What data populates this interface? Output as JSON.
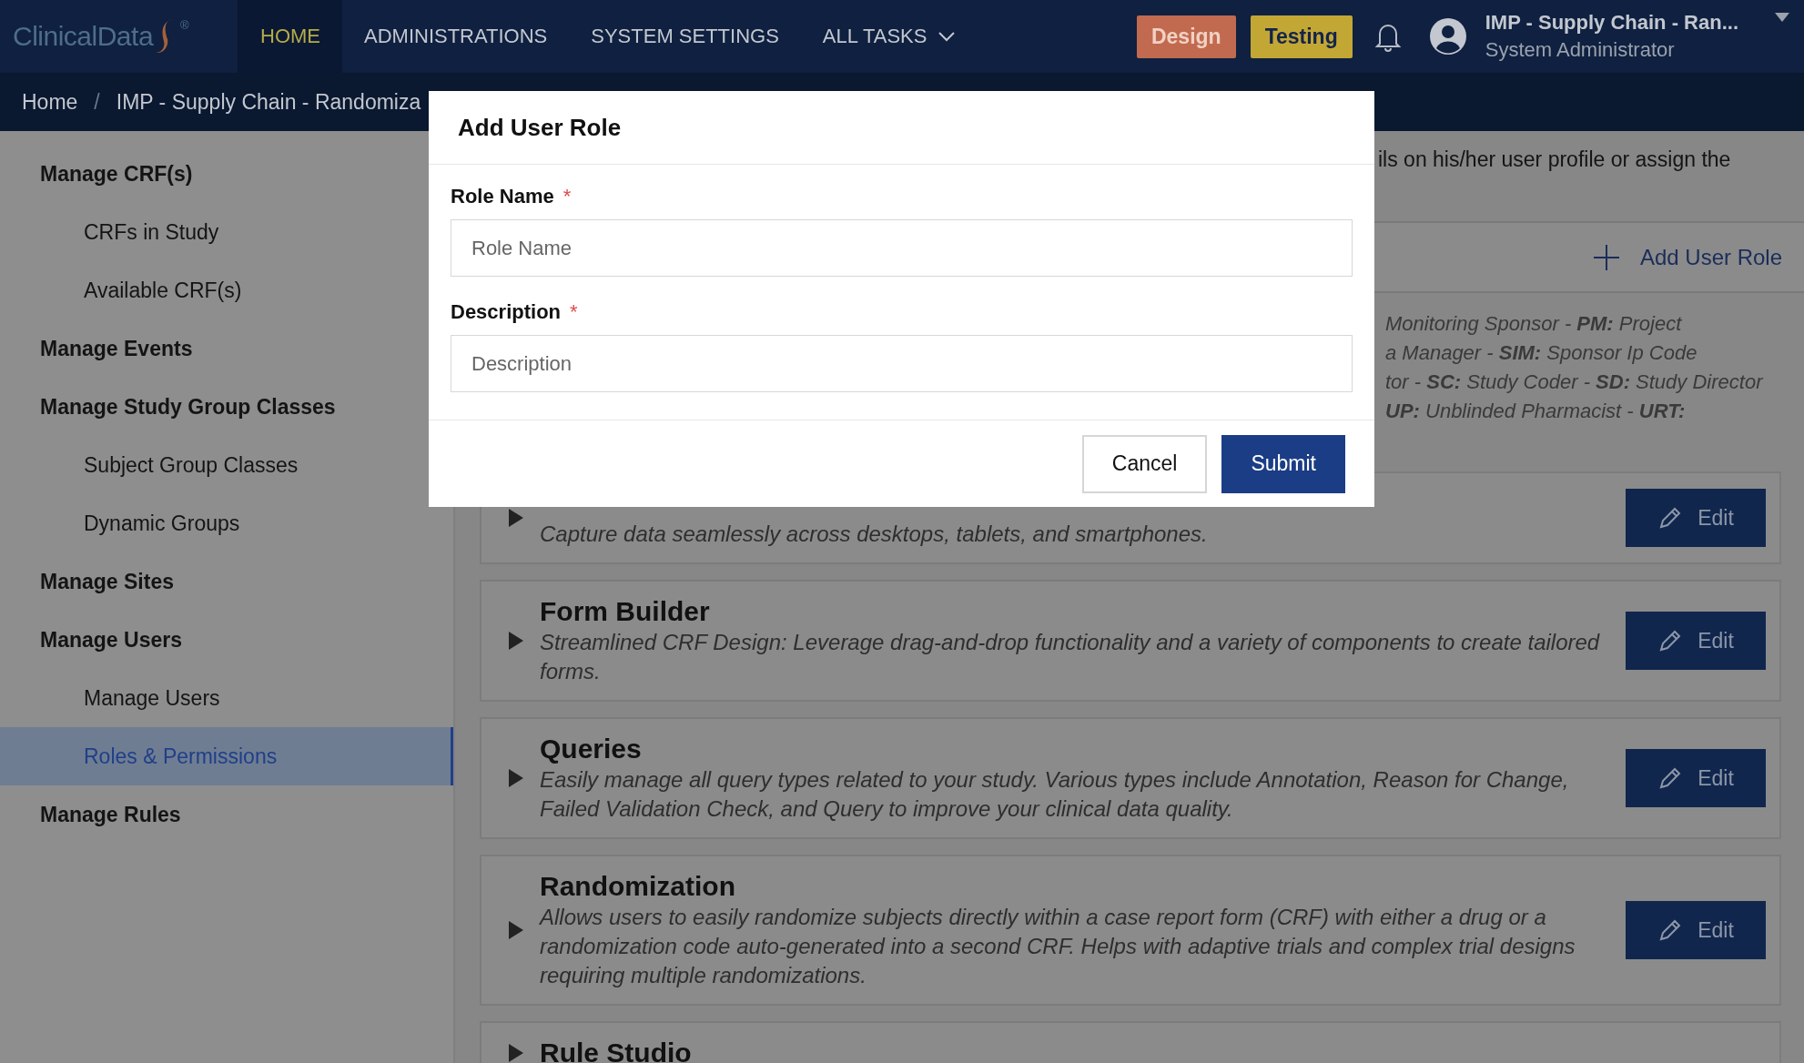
{
  "logo": {
    "text": "ClinicalData",
    "mark": "®"
  },
  "nav": [
    {
      "label": "HOME",
      "selected": true,
      "has_menu": false
    },
    {
      "label": "ADMINISTRATIONS",
      "selected": false,
      "has_menu": false
    },
    {
      "label": "SYSTEM SETTINGS",
      "selected": false,
      "has_menu": false
    },
    {
      "label": "ALL TASKS",
      "selected": false,
      "has_menu": true
    }
  ],
  "environments": [
    {
      "label": "Design",
      "color": "#c26a4f"
    },
    {
      "label": "Testing",
      "color": "#c3a734"
    }
  ],
  "user": {
    "study": "IMP - Supply Chain - Ran...",
    "role": "System Administrator"
  },
  "breadcrumb": {
    "separator": "/",
    "items": [
      "Home",
      "IMP - Supply Chain - Randomiza"
    ]
  },
  "sidebar": {
    "items": [
      {
        "label": "Manage CRF(s)",
        "selected": false,
        "children": [
          {
            "label": "CRFs in Study",
            "selected": false
          },
          {
            "label": "Available CRF(s)",
            "selected": false
          }
        ]
      },
      {
        "label": "Manage Events",
        "selected": false
      },
      {
        "label": "Manage Study Group Classes",
        "selected": false,
        "children": [
          {
            "label": "Subject Group Classes",
            "selected": false
          },
          {
            "label": "Dynamic Groups",
            "selected": false
          }
        ]
      },
      {
        "label": "Manage Sites",
        "selected": false
      },
      {
        "label": "Manage Users",
        "selected": false,
        "children": [
          {
            "label": "Manage Users",
            "selected": false
          },
          {
            "label": "Roles & Permissions",
            "selected": true
          }
        ]
      },
      {
        "label": "Manage Rules",
        "selected": false
      }
    ]
  },
  "main": {
    "intro": "ils on his/her user profile or assign the",
    "add_button": "Add User Role",
    "legend": [
      "Monitoring Sponsor - **PM:** Project",
      "a Manager - **SIM:** Sponsor Ip Code",
      "tor - **SC:** Study Coder - **SD:** Study Director",
      "**UP:** Unblinded Pharmacist - **URT:**"
    ],
    "modules": [
      {
        "description": "Capture data seamlessly across desktops, tablets, and smartphones.",
        "action": "Edit",
        "expanded": false
      },
      {
        "title": "Form Builder",
        "description": "Streamlined CRF Design: Leverage drag-and-drop functionality and a variety of components to create tailored forms.",
        "action": "Edit",
        "expanded": false
      },
      {
        "title": "Queries",
        "description": "Easily manage all query types related to your study. Various types include Annotation, Reason for Change, Failed Validation Check, and Query to improve your clinical data quality.",
        "action": "Edit",
        "expanded": false
      },
      {
        "title": "Randomization",
        "description": "Allows users to easily randomize subjects directly within a case report form (CRF) with either a drug or a randomization code auto-generated into a second CRF. Helps with adaptive trials and complex trial designs requiring multiple randomizations.",
        "action": "Edit",
        "expanded": false
      },
      {
        "title": "Rule Studio",
        "expanded": false
      }
    ]
  },
  "dialog": {
    "title": "Add User Role",
    "required_mark": "*",
    "fields": [
      {
        "label": "Role Name",
        "required": true,
        "placeholder": "Role Name"
      },
      {
        "label": "Description",
        "required": true,
        "placeholder": "Description"
      }
    ],
    "buttons": [
      {
        "label": "Cancel",
        "kind": "secondary"
      },
      {
        "label": "Submit",
        "kind": "primary"
      }
    ]
  }
}
